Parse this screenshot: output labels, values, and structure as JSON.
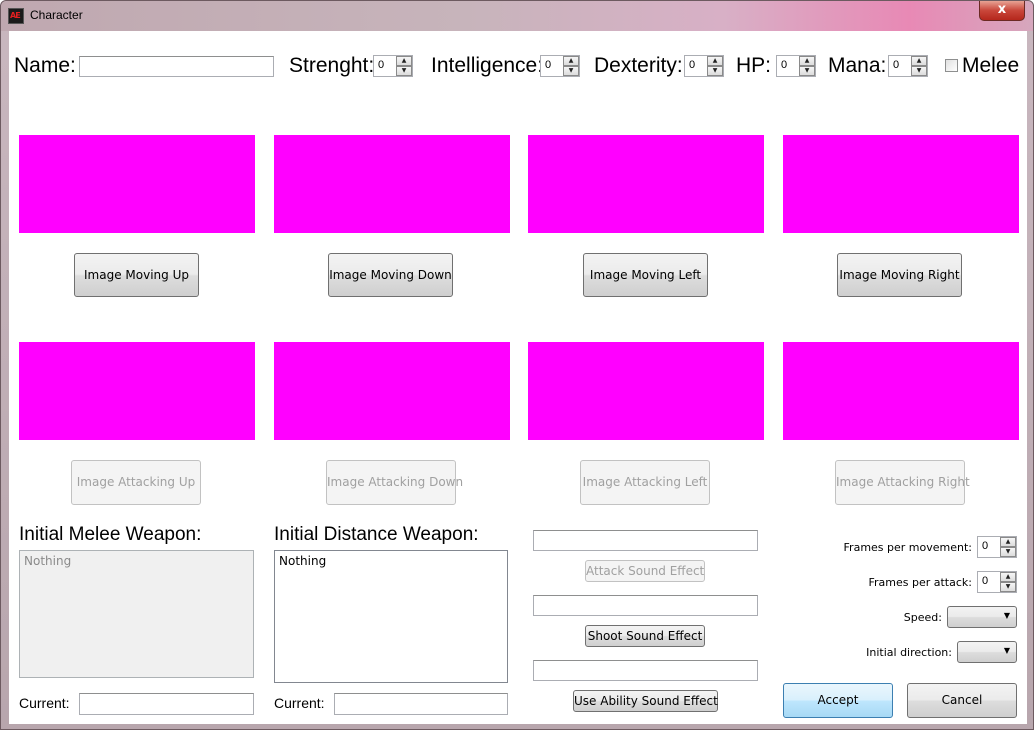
{
  "window": {
    "title": "Character",
    "close_glyph": "x",
    "icon": "app-logo-icon"
  },
  "stats": {
    "name_label": "Name:",
    "name_value": "",
    "strength_label": "Strenght:",
    "strength_value": "0",
    "intelligence_label": "Intelligence:",
    "intelligence_value": "0",
    "dexterity_label": "Dexterity:",
    "dexterity_value": "0",
    "hp_label": "HP:",
    "hp_value": "0",
    "mana_label": "Mana:",
    "mana_value": "0",
    "melee_label": "Melee",
    "melee_checked": false
  },
  "images": {
    "placeholder_color": "#ff00ff",
    "moving": [
      {
        "label": "Image Moving Up"
      },
      {
        "label": "Image Moving Down"
      },
      {
        "label": "Image Moving Left"
      },
      {
        "label": "Image Moving Right"
      }
    ],
    "attacking": [
      {
        "label": "Image Attacking Up"
      },
      {
        "label": "Image Attacking Down"
      },
      {
        "label": "Image Attacking Left"
      },
      {
        "label": "Image Attacking Right"
      }
    ]
  },
  "weapons": {
    "melee_title": "Initial Melee Weapon:",
    "melee_items": [
      "Nothing"
    ],
    "melee_current_label": "Current:",
    "melee_current_value": "",
    "distance_title": "Initial Distance Weapon:",
    "distance_items": [
      "Nothing"
    ],
    "distance_current_label": "Current:",
    "distance_current_value": ""
  },
  "sounds": {
    "attack_value": "",
    "attack_button": "Attack Sound Effect",
    "shoot_value": "",
    "shoot_button": "Shoot Sound Effect",
    "ability_value": "",
    "ability_button": "Use Ability Sound Effect"
  },
  "settings": {
    "frames_movement_label": "Frames per movement:",
    "frames_movement_value": "0",
    "frames_attack_label": "Frames per attack:",
    "frames_attack_value": "0",
    "speed_label": "Speed:",
    "speed_value": "",
    "direction_label": "Initial direction:",
    "direction_value": ""
  },
  "actions": {
    "accept": "Accept",
    "cancel": "Cancel"
  }
}
